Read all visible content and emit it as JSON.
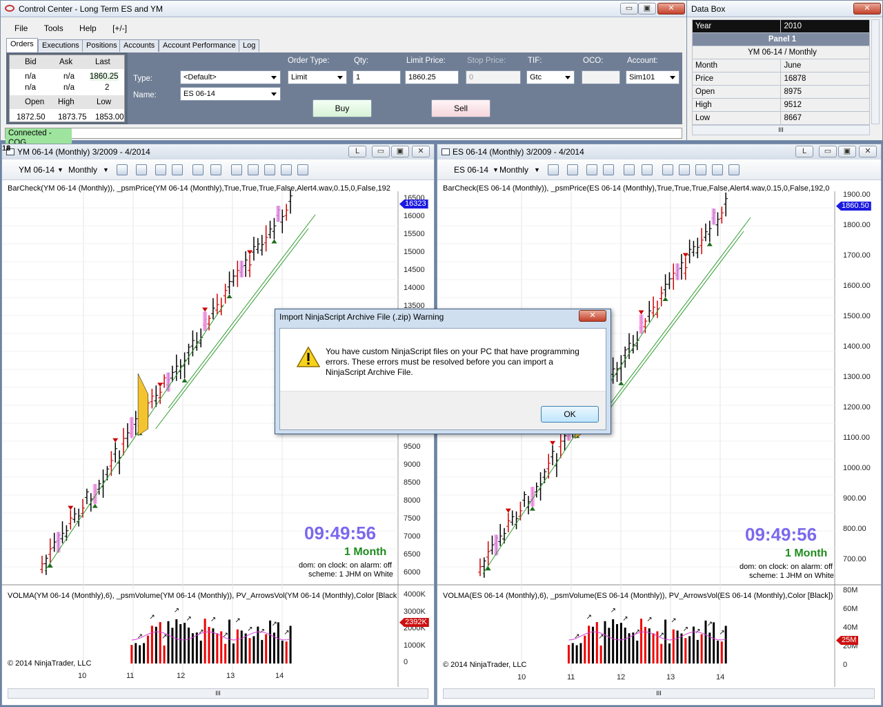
{
  "control_center": {
    "title": "Control Center - Long Term ES and YM",
    "menu": [
      "File",
      "Tools",
      "Help",
      "[+/-]"
    ],
    "tabs": [
      "Orders",
      "Executions",
      "Positions",
      "Accounts",
      "Account Performance",
      "Log"
    ],
    "quote": {
      "bid_label": "Bid",
      "ask_label": "Ask",
      "last_label": "Last",
      "bid1": "n/a",
      "ask1": "n/a",
      "last1": "1860.25",
      "bid2": "n/a",
      "ask2": "n/a",
      "last2": "2",
      "open_label": "Open",
      "high_label": "High",
      "low_label": "Low",
      "open": "1872.50",
      "high": "1873.75",
      "low": "1853.00"
    },
    "form": {
      "type_label": "Type:",
      "type_value": "<Default>",
      "name_label": "Name:",
      "name_value": "ES 06-14",
      "order_type_label": "Order Type:",
      "order_type_value": "Limit",
      "qty_label": "Qty:",
      "qty_value": "1",
      "limit_label": "Limit Price:",
      "limit_value": "1860.25",
      "stop_label": "Stop Price:",
      "stop_value": "0",
      "tif_label": "TIF:",
      "tif_value": "Gtc",
      "oco_label": "OCO:",
      "account_label": "Account:",
      "account_value": "Sim101",
      "buy_label": "Buy",
      "sell_label": "Sell"
    },
    "status": "Connected - CQG"
  },
  "data_box": {
    "title": "Data Box",
    "year_label": "Year",
    "year_value": "2010",
    "panel": "Panel 1",
    "instrument": "YM 06-14 / Monthly",
    "rows": [
      {
        "k": "Month",
        "v": "June"
      },
      {
        "k": "Price",
        "v": "16878"
      },
      {
        "k": "Open",
        "v": "8975"
      },
      {
        "k": "High",
        "v": "9512"
      },
      {
        "k": "Low",
        "v": "8667"
      }
    ],
    "scroll_label": "III"
  },
  "chart_left": {
    "title": "YM 06-14 (Monthly)  3/2009 - 4/2014",
    "instrument": "YM 06-14",
    "interval": "Monthly",
    "study": "BarCheck(YM 06-14 (Monthly)), _psmPrice(YM 06-14 (Monthly),True,True,True,False,Alert4.wav,0.15,0,False,192",
    "y_ticks": [
      "16500",
      "16000",
      "15500",
      "15000",
      "14500",
      "14000",
      "13500",
      "9500",
      "9000",
      "8500",
      "8000",
      "7500",
      "7000",
      "6500",
      "6000"
    ],
    "price_tag": "16323",
    "clock": "09:49:56",
    "period": "1 Month",
    "dom": "dom: on clock: on alarm: off",
    "scheme": "scheme: 1 JHM on White",
    "vol_study": "VOLMA(YM 06-14 (Monthly),6), _psmVolume(YM 06-14 (Monthly)), PV_ArrowsVol(YM 06-14 (Monthly),Color [Black",
    "vol_ticks": [
      "4000K",
      "3000K",
      "2000K",
      "1000K",
      "0"
    ],
    "vol_tag": "2392K",
    "copyright": "© 2014 NinjaTrader, LLC",
    "x_ticks": [
      "10",
      "11",
      "12",
      "13",
      "14"
    ],
    "scroll_label": "III"
  },
  "chart_right": {
    "title": "ES 06-14 (Monthly)  3/2009 - 4/2014",
    "instrument": "ES 06-14",
    "interval": "Monthly",
    "study": "BarCheck(ES 06-14 (Monthly)), _psmPrice(ES 06-14 (Monthly),True,True,True,False,Alert4.wav,0.15,0,False,192,0",
    "y_ticks": [
      "1900.00",
      "1800.00",
      "1700.00",
      "1600.00",
      "1500.00",
      "1400.00",
      "1300.00",
      "1200.00",
      "1100.00",
      "1000.00",
      "900.00",
      "800.00",
      "700.00"
    ],
    "price_tag": "1860.50",
    "clock": "09:49:56",
    "period": "1 Month",
    "dom": "dom: on clock: on alarm: off",
    "scheme": "scheme: 1 JHM on White",
    "vol_study": "VOLMA(ES 06-14 (Monthly),6), _psmVolume(ES 06-14 (Monthly)), PV_ArrowsVol(ES 06-14 (Monthly),Color [Black])",
    "vol_ticks": [
      "80M",
      "60M",
      "40M",
      "20M",
      "0"
    ],
    "vol_tag": "25M",
    "copyright": "© 2014 NinjaTrader, LLC",
    "x_ticks": [
      "10",
      "11",
      "12",
      "13",
      "14"
    ],
    "scroll_label": "III"
  },
  "dialog": {
    "title": "Import NinjaScript Archive File (.zip) Warning",
    "message": "You have custom NinjaScript files on your PC that have programming errors. These errors must be resolved before you can import a NinjaScript Archive File.",
    "ok": "OK"
  },
  "window_buttons": {
    "restore": "L",
    "min": "▭",
    "max": "▣",
    "close": "✕"
  },
  "colors": {
    "up_bar": "#000000",
    "down_bar": "#cc0000",
    "trend": "#2e9b2e",
    "accent_clock": "#7b68ee",
    "period": "#1e8c1e"
  }
}
